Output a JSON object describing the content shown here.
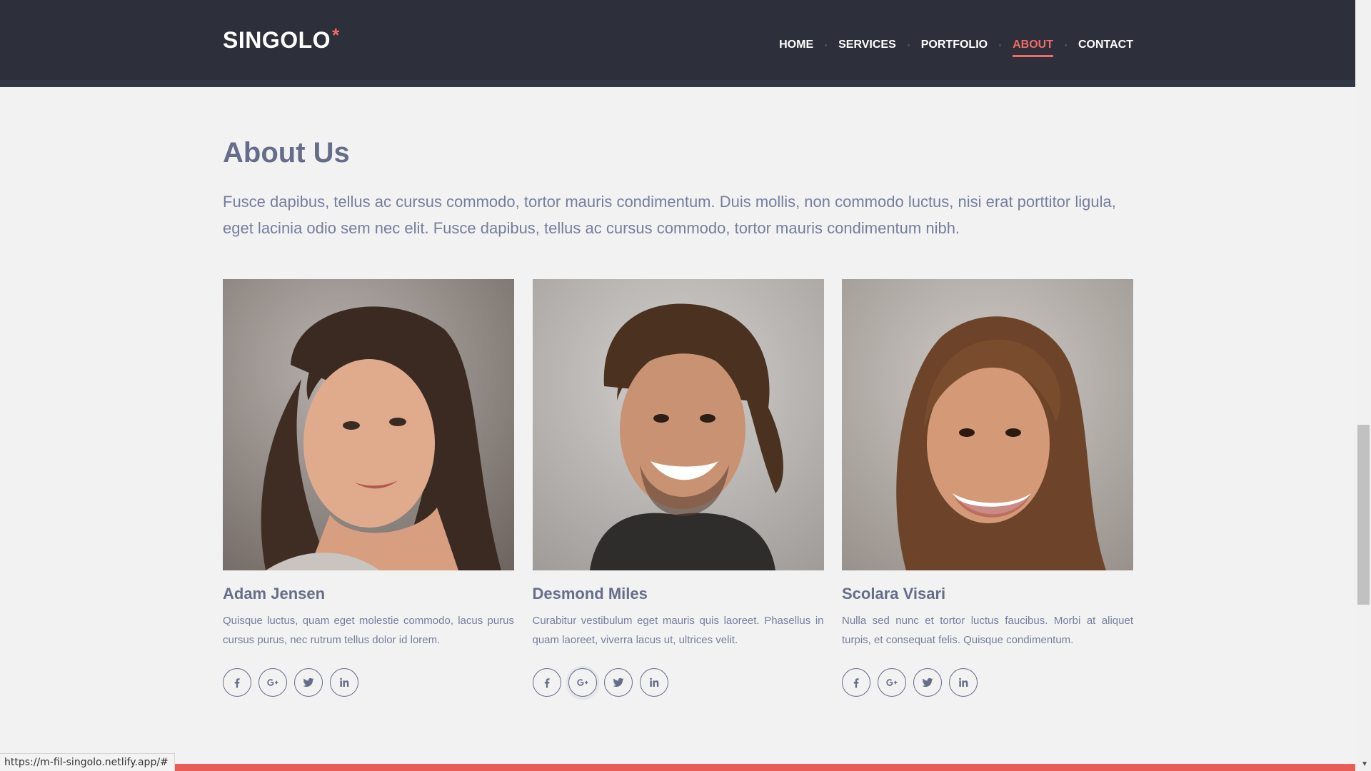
{
  "header": {
    "logo_text": "SINGOLO",
    "logo_star": "*",
    "nav": [
      {
        "label": "HOME",
        "active": false
      },
      {
        "label": "SERVICES",
        "active": false
      },
      {
        "label": "PORTFOLIO",
        "active": false
      },
      {
        "label": "ABOUT",
        "active": true
      },
      {
        "label": "CONTACT",
        "active": false
      }
    ]
  },
  "about": {
    "title": "About Us",
    "intro": "Fusce dapibus, tellus ac cursus commodo, tortor mauris condimentum. Duis mollis, non commodo luctus, nisi erat porttitor ligula, eget lacinia odio sem nec elit. Fusce dapibus, tellus ac cursus commodo, tortor mauris condimentum nibh.",
    "members": [
      {
        "name": "Adam Jensen",
        "bio": "Quisque luctus, quam eget molestie commodo, lacus purus cursus purus, nec rutrum tellus dolor id lorem.",
        "photo": "portrait-woman-dark-hair"
      },
      {
        "name": "Desmond Miles",
        "bio": "Curabitur vestibulum eget mauris quis laoreet. Phasellus in quam laoreet, viverra lacus ut, ultrices velit.",
        "photo": "portrait-man-smiling"
      },
      {
        "name": "Scolara Visari",
        "bio": "Nulla sed nunc et tortor luctus faucibus. Morbi at aliquet turpis, et consequat felis. Quisque condimentum.",
        "photo": "portrait-woman-smiling"
      }
    ],
    "social_icons": [
      "facebook-icon",
      "google-plus-icon",
      "twitter-icon",
      "linkedin-icon"
    ]
  },
  "status_bar": {
    "url": "https://m-fil-singolo.netlify.app/#"
  },
  "colors": {
    "header_bg": "#2d303a",
    "accent": "#f06c64",
    "text_dark": "#666d89",
    "text_light": "#767e9e",
    "page_bg": "#f2f2f2"
  }
}
